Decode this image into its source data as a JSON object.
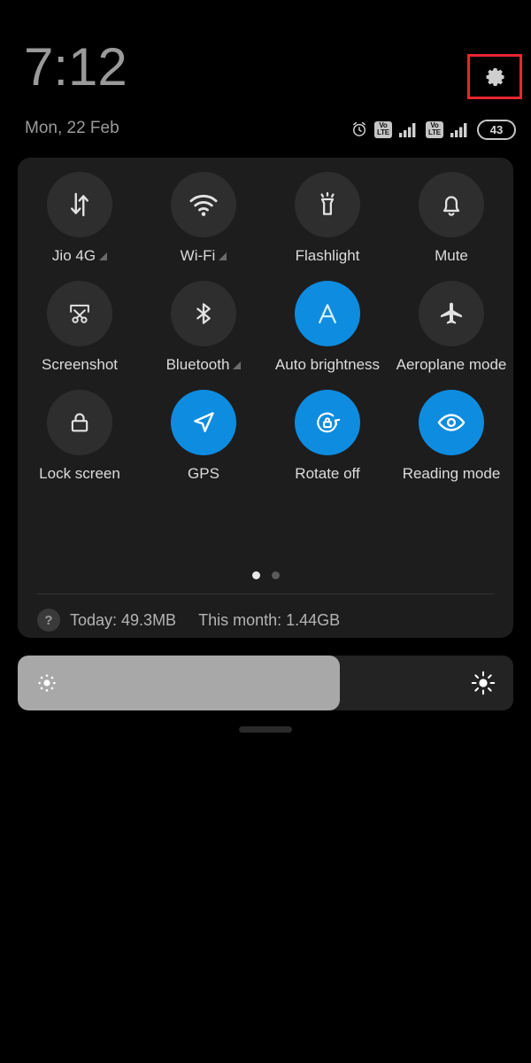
{
  "statusbar": {
    "time": "7:12",
    "date": "Mon, 22 Feb",
    "settings_icon": "gear-icon",
    "highlight_color": "#e8262e",
    "icons": [
      {
        "name": "alarm-icon",
        "label": ""
      },
      {
        "name": "volte-icon-sim1",
        "line1": "Vo",
        "line2": "LTE"
      },
      {
        "name": "signal-bars-icon-sim1",
        "label": ""
      },
      {
        "name": "volte-icon-sim2",
        "line1": "Vo",
        "line2": "LTE"
      },
      {
        "name": "signal-bars-icon-sim2",
        "label": ""
      }
    ],
    "battery": {
      "level": "43",
      "name": "battery-badge"
    }
  },
  "panel": {
    "accent_color": "#0e8ce0",
    "inactive_color": "#2e2e2e",
    "tiles": [
      {
        "label": "Jio 4G",
        "icon": "mobile-data-icon",
        "active": false,
        "expandable": true
      },
      {
        "label": "Wi-Fi",
        "icon": "wifi-icon",
        "active": false,
        "expandable": true
      },
      {
        "label": "Flashlight",
        "icon": "flashlight-icon",
        "active": false,
        "expandable": false
      },
      {
        "label": "Mute",
        "icon": "bell-icon",
        "active": false,
        "expandable": false
      },
      {
        "label": "Screenshot",
        "icon": "screenshot-icon",
        "active": false,
        "expandable": false
      },
      {
        "label": "Bluetooth",
        "icon": "bluetooth-icon",
        "active": false,
        "expandable": true
      },
      {
        "label": "Auto brightness",
        "icon": "auto-brightness-icon",
        "active": true,
        "expandable": false
      },
      {
        "label": "Aeroplane mode",
        "icon": "airplane-icon",
        "active": false,
        "expandable": false
      },
      {
        "label": "Lock screen",
        "icon": "lock-icon",
        "active": false,
        "expandable": false
      },
      {
        "label": "GPS",
        "icon": "location-arrow-icon",
        "active": true,
        "expandable": false
      },
      {
        "label": "Rotate off",
        "icon": "rotate-lock-icon",
        "active": true,
        "expandable": false
      },
      {
        "label": "Reading mode",
        "icon": "eye-icon",
        "active": true,
        "expandable": false
      }
    ],
    "pages": {
      "count": 2,
      "current": 1
    },
    "data_usage": {
      "help_icon": "?",
      "today": "Today: 49.3MB",
      "month": "This month: 1.44GB"
    }
  },
  "brightness": {
    "name": "brightness-slider",
    "fill_percent": 65,
    "low_icon": "brightness-low-icon",
    "high_icon": "brightness-high-icon"
  },
  "drag_handle": {
    "name": "panel-drag-handle"
  }
}
